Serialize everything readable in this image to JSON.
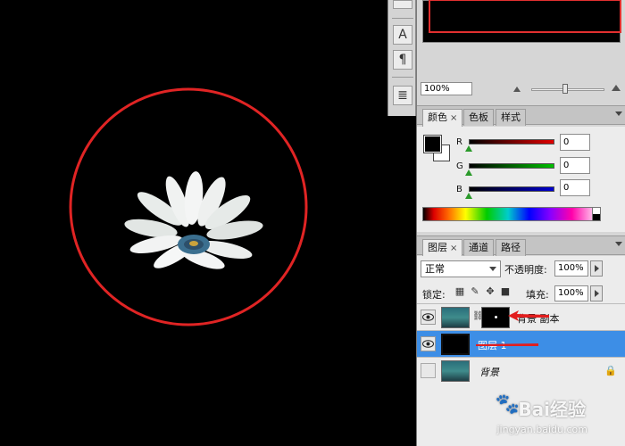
{
  "canvas": {
    "circle_color": "#e02424",
    "background": "#000000"
  },
  "toolstrip": {
    "tools": [
      {
        "icon": "character-icon"
      },
      {
        "icon": "paragraph-icon"
      },
      {
        "icon": "layer-comps-icon"
      }
    ]
  },
  "navigator": {
    "zoom_value": "100%"
  },
  "color_panel": {
    "tabs": [
      {
        "label": "颜色",
        "active": true
      },
      {
        "label": "色板",
        "active": false
      },
      {
        "label": "样式",
        "active": false
      }
    ],
    "channels": [
      {
        "label": "R",
        "value": "0",
        "color": "#e00000"
      },
      {
        "label": "G",
        "value": "0",
        "color": "#00c000"
      },
      {
        "label": "B",
        "value": "0",
        "color": "#0000d0"
      }
    ],
    "foreground": "#000000",
    "background": "#ffffff"
  },
  "layers_panel": {
    "tabs": [
      {
        "label": "图层",
        "active": true
      },
      {
        "label": "通道",
        "active": false
      },
      {
        "label": "路径",
        "active": false
      }
    ],
    "blend_mode": "正常",
    "opacity_label": "不透明度:",
    "opacity_value": "100%",
    "lock_label": "锁定:",
    "fill_label": "填充:",
    "fill_value": "100%",
    "layers": [
      {
        "name": "背景 副本",
        "visible": true,
        "selected": false,
        "has_mask": true
      },
      {
        "name": "图层 1",
        "visible": true,
        "selected": true,
        "has_mask": false
      },
      {
        "name": "背景",
        "visible": false,
        "selected": false,
        "has_mask": false,
        "locked": true
      }
    ]
  },
  "watermark": {
    "brand": "Bai经验",
    "url": "jingyan.baidu.com"
  }
}
